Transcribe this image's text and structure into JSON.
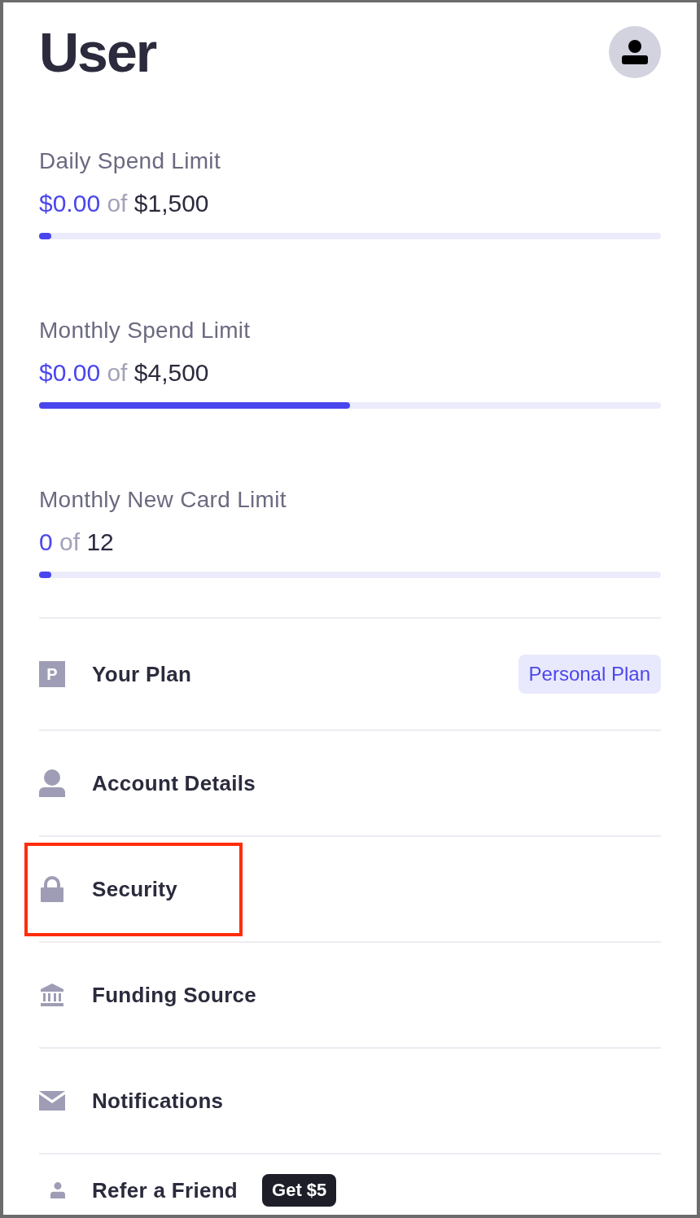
{
  "header": {
    "title": "User"
  },
  "limits": [
    {
      "label": "Daily Spend Limit",
      "used": "$0.00",
      "connector": "of",
      "total": "$1,500",
      "level": 0.02
    },
    {
      "label": "Monthly Spend Limit",
      "used": "$0.00",
      "connector": "of",
      "total": "$4,500",
      "level": 0.5
    },
    {
      "label": "Monthly New Card Limit",
      "used": "0",
      "connector": "of",
      "total": "12",
      "level": 0.02
    }
  ],
  "menu": [
    {
      "kind": "plan",
      "icon_text": "P",
      "label": "Your Plan",
      "tag": "Personal Plan",
      "highlighted": false
    },
    {
      "kind": "person",
      "label": "Account Details",
      "highlighted": false
    },
    {
      "kind": "lock",
      "label": "Security",
      "highlighted": true
    },
    {
      "kind": "bank",
      "label": "Funding Source",
      "highlighted": false
    },
    {
      "kind": "mail",
      "label": "Notifications",
      "highlighted": false
    },
    {
      "kind": "referral",
      "label": "Refer a Friend",
      "badge": "Get $5",
      "highlighted": false
    }
  ]
}
